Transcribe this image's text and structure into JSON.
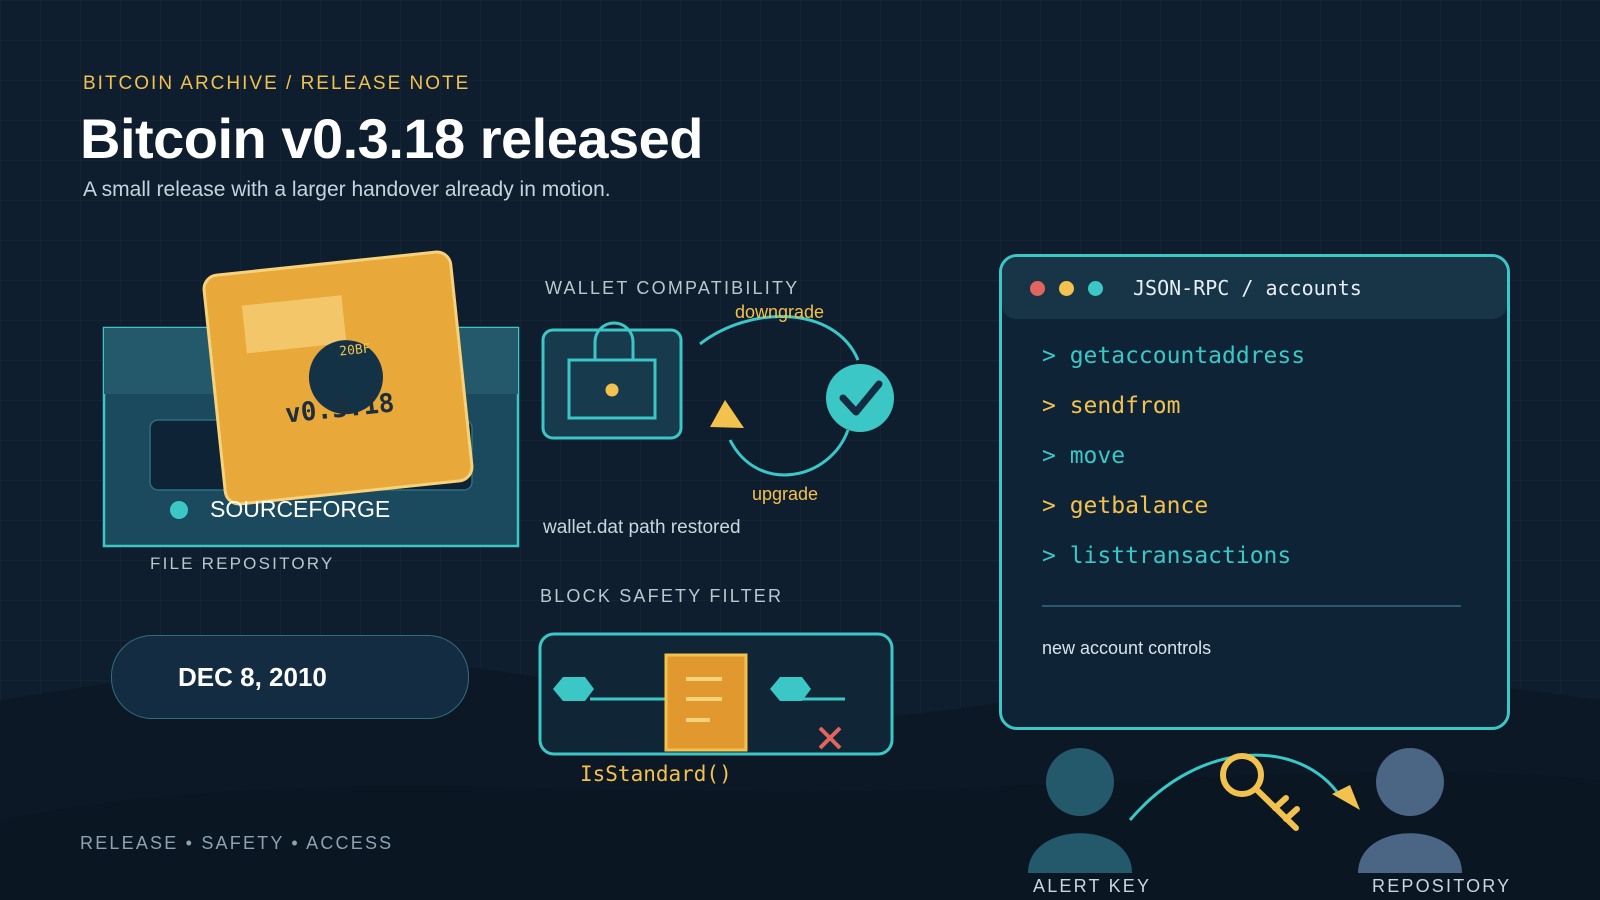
{
  "header": {
    "kicker": "BITCOIN ARCHIVE / RELEASE NOTE",
    "title": "Bitcoin v0.3.18 released",
    "subtitle": "A small release with a larger handover already in motion."
  },
  "repository": {
    "badge_version": "v0.3.18",
    "badge_glyph": "20BF",
    "name": "SOURCEFORGE",
    "caption": "FILE REPOSITORY"
  },
  "date_pill": "DEC 8, 2010",
  "wallet": {
    "heading": "WALLET COMPATIBILITY",
    "downgrade_label": "downgrade",
    "upgrade_label": "upgrade",
    "caption": "wallet.dat path restored"
  },
  "filter": {
    "heading": "BLOCK SAFETY FILTER",
    "function_label": "IsStandard()"
  },
  "terminal": {
    "title": "JSON-RPC / accounts",
    "commands": [
      {
        "text": "> getaccountaddress",
        "color": "#3cc7c7"
      },
      {
        "text": "> sendfrom",
        "color": "#f2c14e"
      },
      {
        "text": "> move",
        "color": "#3cc7c7"
      },
      {
        "text": "> getbalance",
        "color": "#f2c14e"
      },
      {
        "text": "> listtransactions",
        "color": "#3cc7c7"
      }
    ],
    "footer": "new account controls"
  },
  "handover": {
    "left_label": "ALERT KEY",
    "right_label": "REPOSITORY"
  },
  "footer_tagline": "RELEASE • SAFETY • ACCESS",
  "colors": {
    "background": "#0f1e2e",
    "accent_teal": "#3cc7c7",
    "accent_gold": "#f2c14e",
    "badge_orange": "#e9a83a",
    "error_red": "#e0655f"
  },
  "icons": [
    "folder-icon",
    "package-icon",
    "bitcoin-symbol-icon",
    "lock-icon",
    "check-circle-icon",
    "cycle-arrows-icon",
    "document-filter-icon",
    "block-icon",
    "x-mark-icon",
    "user-icon",
    "key-icon",
    "arrow-icon"
  ]
}
